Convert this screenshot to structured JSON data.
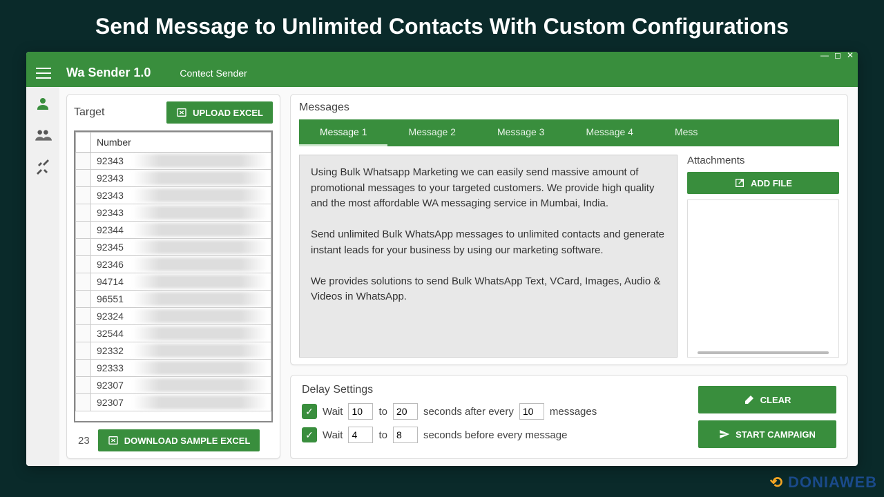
{
  "hero": "Send Message to Unlimited Contacts With Custom Configurations",
  "header": {
    "title": "Wa Sender 1.0",
    "subtitle": "Contect Sender"
  },
  "target": {
    "title": "Target",
    "upload_btn": "UPLOAD EXCEL",
    "column": "Number",
    "rows": [
      "92343",
      "92343",
      "92343",
      "92343",
      "92344",
      "92345",
      "92346",
      "94714",
      "96551",
      "92324",
      "32544",
      "92332",
      "92333",
      "92307",
      "92307"
    ],
    "count": "23",
    "download_btn": "DOWNLOAD SAMPLE EXCEL"
  },
  "messages": {
    "title": "Messages",
    "tabs": [
      "Message 1",
      "Message 2",
      "Message 3",
      "Message 4",
      "Mess"
    ],
    "body": "Using Bulk Whatsapp Marketing we can easily send massive amount of promotional messages to your targeted customers. We provide high quality and the most affordable WA messaging service in Mumbai, India.\n\nSend unlimited Bulk WhatsApp messages to unlimited contacts and generate instant leads for your business by using our marketing software.\n\nWe  provides solutions to send Bulk WhatsApp Text, VCard, Images, Audio & Videos in WhatsApp.",
    "attachments_title": "Attachments",
    "add_file": "ADD FILE"
  },
  "delay": {
    "title": "Delay Settings",
    "row1": {
      "wait": "Wait",
      "min": "10",
      "to": "to",
      "max": "20",
      "after": "seconds after every",
      "count": "10",
      "msgs": "messages"
    },
    "row2": {
      "wait": "Wait",
      "min": "4",
      "to": "to",
      "max": "8",
      "before": "seconds before every message"
    },
    "clear": "CLEAR",
    "start": "START CAMPAIGN"
  },
  "watermark": "DONIAWEB"
}
